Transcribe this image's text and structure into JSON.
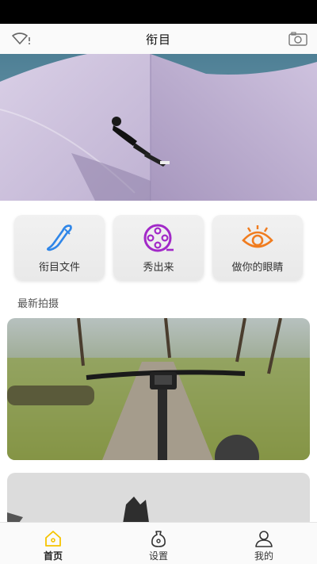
{
  "nav": {
    "title": "衔目",
    "left_icon": "signal-wifi-icon",
    "right_icon": "camera-icon"
  },
  "hero": {
    "image": "skateboarder-on-curved-wall-photo"
  },
  "quick_actions": [
    {
      "label": "衔目文件",
      "icon": "brush-pen-icon",
      "color": "#2f86e8"
    },
    {
      "label": "秀出来",
      "icon": "film-reel-icon",
      "color": "#a229c8"
    },
    {
      "label": "做你的眼睛",
      "icon": "eye-icon",
      "color": "#f07c1f"
    }
  ],
  "section": {
    "title": "最新拍摄"
  },
  "photos": [
    {
      "image": "bicycle-ride-park-path-photo"
    },
    {
      "image": "statue-overcast-sky-photo"
    }
  ],
  "tabs": [
    {
      "label": "首页",
      "icon": "home-icon",
      "active": true
    },
    {
      "label": "设置",
      "icon": "settings-bag-icon",
      "active": false
    },
    {
      "label": "我的",
      "icon": "profile-icon",
      "active": false
    }
  ],
  "colors": {
    "accent_yellow": "#f5c400",
    "brand_blue": "#2f86e8",
    "brand_purple": "#a229c8",
    "brand_orange": "#f07c1f"
  }
}
